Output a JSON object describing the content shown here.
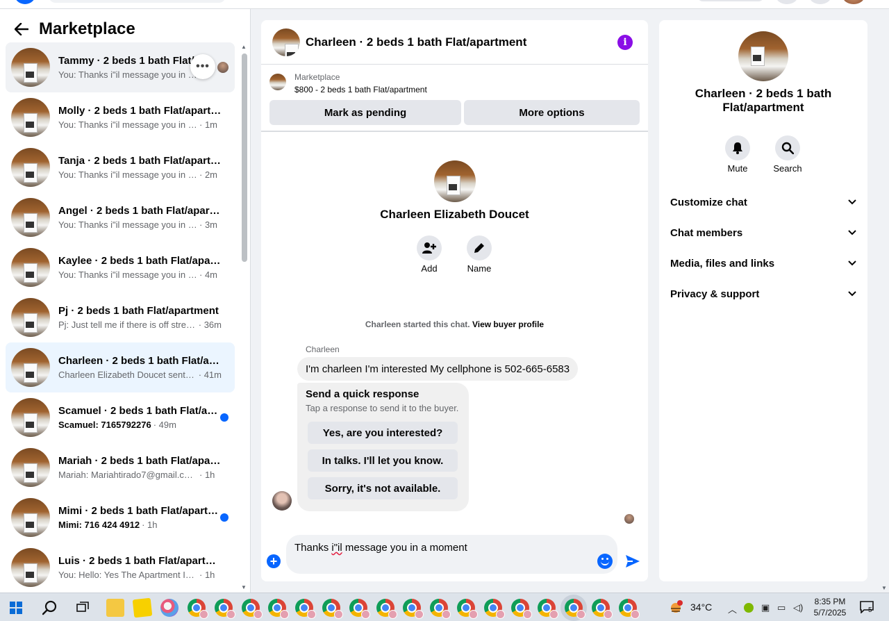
{
  "sidebar": {
    "title": "Marketplace",
    "conversations": [
      {
        "name": "Tammy · 2 beds 1 bath Flat/a…",
        "preview": "You: Thanks i\"il message you in …",
        "time": "",
        "unread": false,
        "state": "hover"
      },
      {
        "name": "Molly · 2 beds 1 bath Flat/apart…",
        "preview": "You: Thanks i\"il message you in a …",
        "time": "· 1m",
        "unread": false,
        "state": ""
      },
      {
        "name": "Tanja · 2 beds 1 bath Flat/apart…",
        "preview": "You: Thanks i\"il message you in a …",
        "time": "· 2m",
        "unread": false,
        "state": ""
      },
      {
        "name": "Angel · 2 beds 1 bath Flat/apart…",
        "preview": "You: Thanks i\"il message you in a …",
        "time": "· 3m",
        "unread": false,
        "state": ""
      },
      {
        "name": "Kaylee · 2 beds 1 bath Flat/apart…",
        "preview": "You: Thanks i\"il message you in a …",
        "time": "· 4m",
        "unread": false,
        "state": ""
      },
      {
        "name": "Pj · 2 beds 1 bath Flat/apartment",
        "preview": "Pj: Just tell me if there is off stree…",
        "time": "· 36m",
        "unread": false,
        "state": ""
      },
      {
        "name": "Charleen · 2 beds 1 bath Flat/ap…",
        "preview": "Charleen Elizabeth Doucet sent y…",
        "time": "· 41m",
        "unread": false,
        "state": "active"
      },
      {
        "name": "Scamuel · 2 beds 1 bath Flat/a…",
        "preview": "Scamuel: 7165792276",
        "time": "· 49m",
        "unread": true,
        "state": ""
      },
      {
        "name": "Mariah · 2 beds 1 bath Flat/apart…",
        "preview": "Mariah: Mariahtirado7@gmail.com …",
        "time": "· 1h",
        "unread": false,
        "state": ""
      },
      {
        "name": "Mimi · 2 beds 1 bath Flat/apart…",
        "preview": "Mimi: 716 424 4912",
        "time": "· 1h",
        "unread": true,
        "state": ""
      },
      {
        "name": "Luis · 2 beds 1 bath Flat/apartme…",
        "preview": "You: Hello: Yes The Apartment Is Sti…",
        "time": "· 1h",
        "unread": false,
        "state": ""
      }
    ],
    "more_label": "•••"
  },
  "chat": {
    "title": "Charleen · 2 beds 1 bath Flat/apartment",
    "info_label": "i",
    "listing": {
      "source": "Marketplace",
      "price_line": "$800 - 2 beds 1 bath Flat/apartment",
      "mark_pending": "Mark as pending",
      "more_options": "More options"
    },
    "intro": {
      "name": "Charleen Elizabeth Doucet",
      "add_label": "Add",
      "name_label": "Name"
    },
    "started_text": "Charleen started this chat.",
    "view_profile": "View buyer profile",
    "sender_name": "Charleen",
    "message": "I'm charleen I'm interested My cellphone is 502-665-6583",
    "quick": {
      "title": "Send a quick response",
      "subtitle": "Tap a response to send it to the buyer.",
      "options": [
        "Yes, are you interested?",
        "In talks. I'll let you know.",
        "Sorry, it's not available."
      ]
    },
    "composer": {
      "before": "Thanks ",
      "misspelled": "i\"il",
      "after": " message you in a moment"
    }
  },
  "details": {
    "title": "Charleen · 2 beds 1 bath Flat/apartment",
    "mute_label": "Mute",
    "search_label": "Search",
    "sections": [
      "Customize chat",
      "Chat members",
      "Media, files and links",
      "Privacy & support"
    ]
  },
  "taskbar": {
    "temperature": "34°C",
    "weather_badge": "1",
    "time": "8:35 PM",
    "date": "5/7/2025",
    "notifications": "5"
  },
  "colors": {
    "accent": "#0866ff",
    "info": "#8a0ee6",
    "active_row": "#ebf5ff",
    "bubble": "#f0f0f0"
  }
}
